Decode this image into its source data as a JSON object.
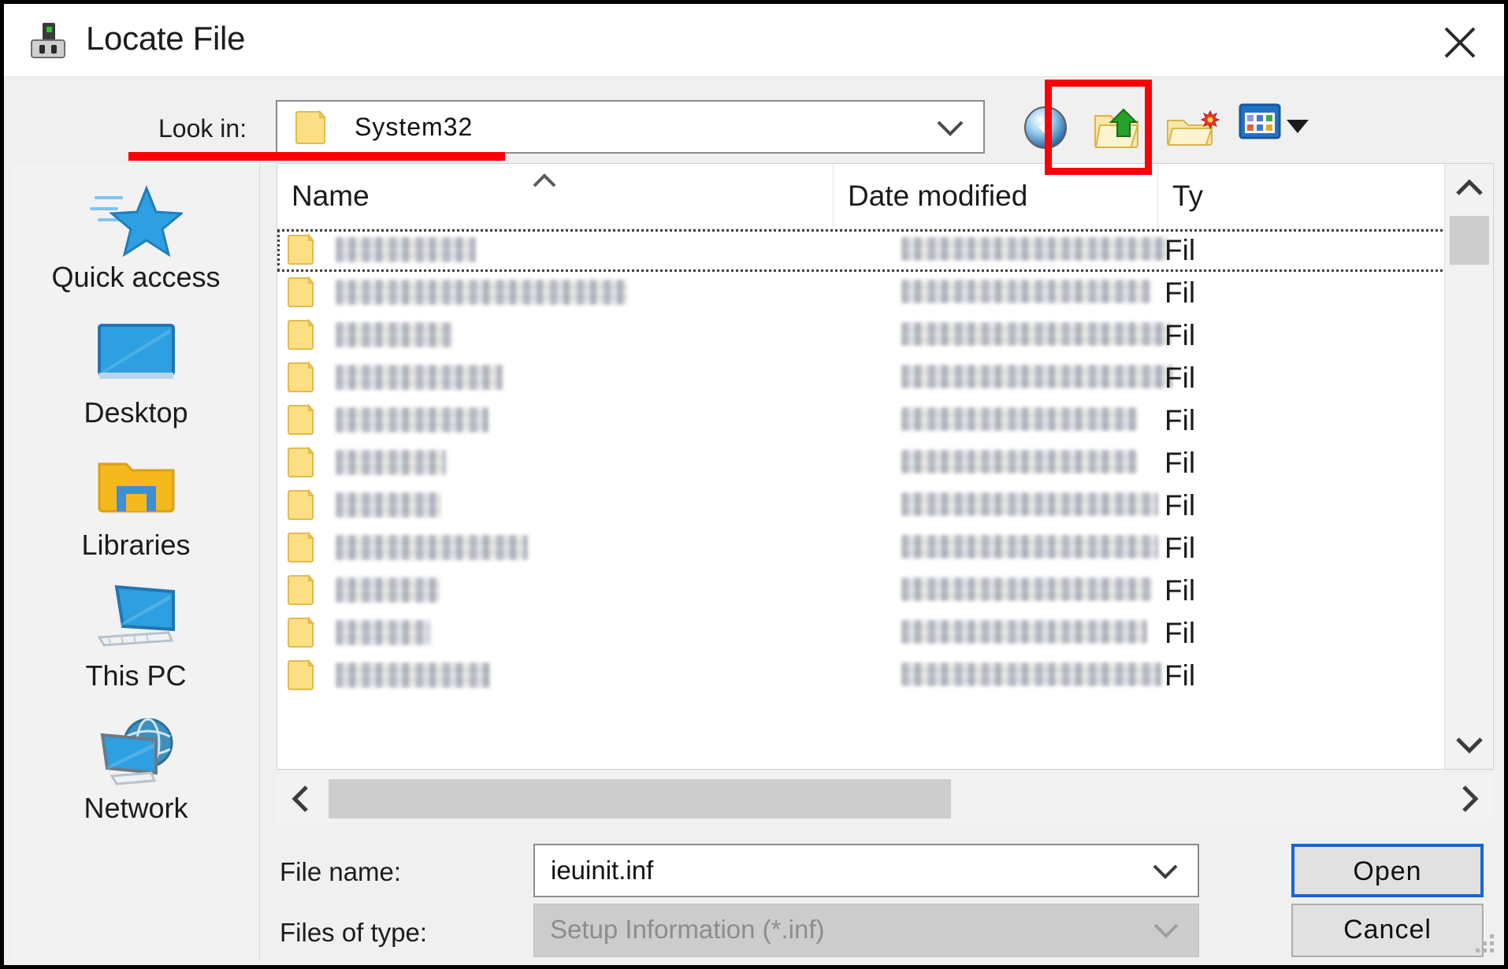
{
  "window": {
    "title": "Locate File",
    "title_icon": "device-icon",
    "close_label": "close-icon"
  },
  "lookin": {
    "label": "Look in:",
    "value": "System32",
    "folder_icon": "folder-icon",
    "chevron_icon": "chevron-down-icon"
  },
  "toolbar": {
    "buttons": [
      {
        "name": "back-button",
        "icon": "back-navigation-icon",
        "tooltip": "Back"
      },
      {
        "name": "up-one-level-button",
        "icon": "up-one-level-folder-icon",
        "tooltip": "Up One Level"
      },
      {
        "name": "new-folder-button",
        "icon": "new-folder-icon",
        "tooltip": "Create New Folder"
      },
      {
        "name": "views-button",
        "icon": "views-icon",
        "tooltip": "Views"
      }
    ]
  },
  "places": {
    "items": [
      {
        "label": "Quick access",
        "icon": "quick-access-star-icon"
      },
      {
        "label": "Desktop",
        "icon": "desktop-monitor-icon"
      },
      {
        "label": "Libraries",
        "icon": "libraries-folder-icon"
      },
      {
        "label": "This PC",
        "icon": "this-pc-computer-icon"
      },
      {
        "label": "Network",
        "icon": "network-globe-icon"
      }
    ]
  },
  "filelist": {
    "columns": [
      {
        "key": "name",
        "label": "Name",
        "sorted": "ascending",
        "sort_icon": "sort-ascending-caret-icon"
      },
      {
        "key": "date",
        "label": "Date modified"
      },
      {
        "key": "type",
        "label": "Ty"
      }
    ],
    "rows": [
      {
        "name": "",
        "date": "",
        "type": "Fil",
        "focused": true,
        "name_w": 178,
        "date_w": 340
      },
      {
        "name": "",
        "date": "",
        "type": "Fil",
        "focused": false,
        "name_w": 370,
        "date_w": 316
      },
      {
        "name": "",
        "date": "",
        "type": "Fil",
        "focused": false,
        "name_w": 148,
        "date_w": 342
      },
      {
        "name": "",
        "date": "",
        "type": "Fil",
        "focused": false,
        "name_w": 212,
        "date_w": 344
      },
      {
        "name": "",
        "date": "",
        "type": "Fil",
        "focused": false,
        "name_w": 194,
        "date_w": 300
      },
      {
        "name": "",
        "date": "",
        "type": "Fil",
        "focused": false,
        "name_w": 140,
        "date_w": 300
      },
      {
        "name": "",
        "date": "",
        "type": "Fil",
        "focused": false,
        "name_w": 134,
        "date_w": 326
      },
      {
        "name": "",
        "date": "",
        "type": "Fil",
        "focused": false,
        "name_w": 244,
        "date_w": 326
      },
      {
        "name": "",
        "date": "",
        "type": "Fil",
        "focused": false,
        "name_w": 132,
        "date_w": 318
      },
      {
        "name": "",
        "date": "",
        "type": "Fil",
        "focused": false,
        "name_w": 120,
        "date_w": 312
      },
      {
        "name": "",
        "date": "",
        "type": "Fil",
        "focused": false,
        "name_w": 196,
        "date_w": 330
      }
    ],
    "vertical_scrollbar": {
      "name": "vertical-scrollbar",
      "up_icon": "scroll-up-chevron-icon",
      "down_icon": "scroll-down-chevron-icon"
    },
    "horizontal_scrollbar": {
      "name": "horizontal-scrollbar",
      "left_icon": "scroll-left-chevron-icon",
      "right_icon": "scroll-right-chevron-icon"
    }
  },
  "fields": {
    "filename_label": "File name:",
    "filename_value": "ieuinit.inf",
    "filetype_label": "Files of type:",
    "filetype_value": "Setup Information (*.inf)"
  },
  "buttons": {
    "open": "Open",
    "cancel": "Cancel"
  },
  "annotations": {
    "underline_color": "#fb0007",
    "box_color": "#fb0007",
    "underline_target": "look-in-row",
    "box_target": "up-one-level-button"
  }
}
